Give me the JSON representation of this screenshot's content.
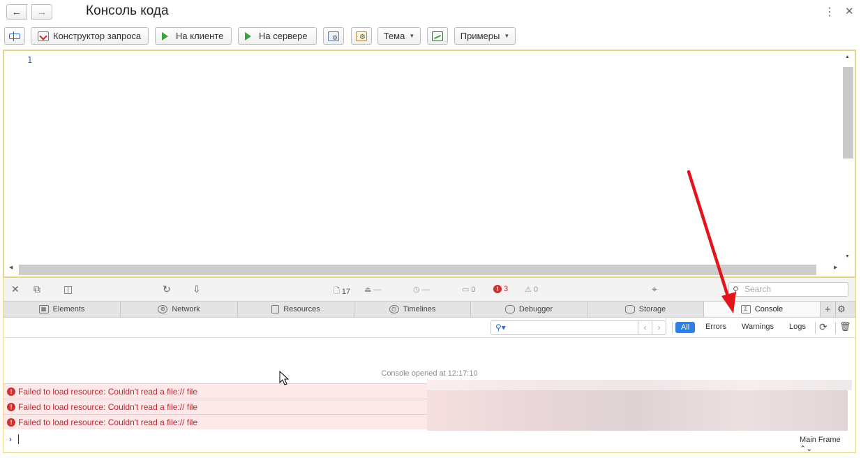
{
  "window": {
    "title": "Консоль кода",
    "nav_back": "←",
    "nav_forward": "→"
  },
  "toolbar": {
    "query_builder_label": "Конструктор запроса",
    "on_client_label": "На клиенте",
    "on_server_label": "На сервере",
    "theme_label": "Тема",
    "examples_label": "Примеры"
  },
  "editor": {
    "line_number": "1"
  },
  "devtools": {
    "stats": {
      "resources": "17",
      "size": "—",
      "time": "—",
      "logs": "0",
      "errors": "3",
      "warnings": "0"
    },
    "search_placeholder": "Search",
    "tabs": [
      {
        "label": "Elements",
        "icon": "elements-icon"
      },
      {
        "label": "Network",
        "icon": "network-icon"
      },
      {
        "label": "Resources",
        "icon": "resources-icon"
      },
      {
        "label": "Timelines",
        "icon": "timelines-icon"
      },
      {
        "label": "Debugger",
        "icon": "debugger-icon"
      },
      {
        "label": "Storage",
        "icon": "storage-icon"
      },
      {
        "label": "Console",
        "icon": "console-icon",
        "active": true
      }
    ],
    "filters": {
      "all": "All",
      "errors": "Errors",
      "warnings": "Warnings",
      "logs": "Logs"
    },
    "console": {
      "opened_message": "Console opened at 12:17:10",
      "errors": [
        "Failed to load resource: Couldn't read a file:// file",
        "Failed to load resource: Couldn't read a file:// file",
        "Failed to load resource: Couldn't read a file:// file"
      ],
      "frame_selector": "Main Frame"
    }
  },
  "colors": {
    "active_filter": "#2f7ee6",
    "error_text": "#c0262d",
    "error_bg": "#fde9ea",
    "run_icon": "#3ca03c",
    "editor_border": "#e8d48b"
  }
}
